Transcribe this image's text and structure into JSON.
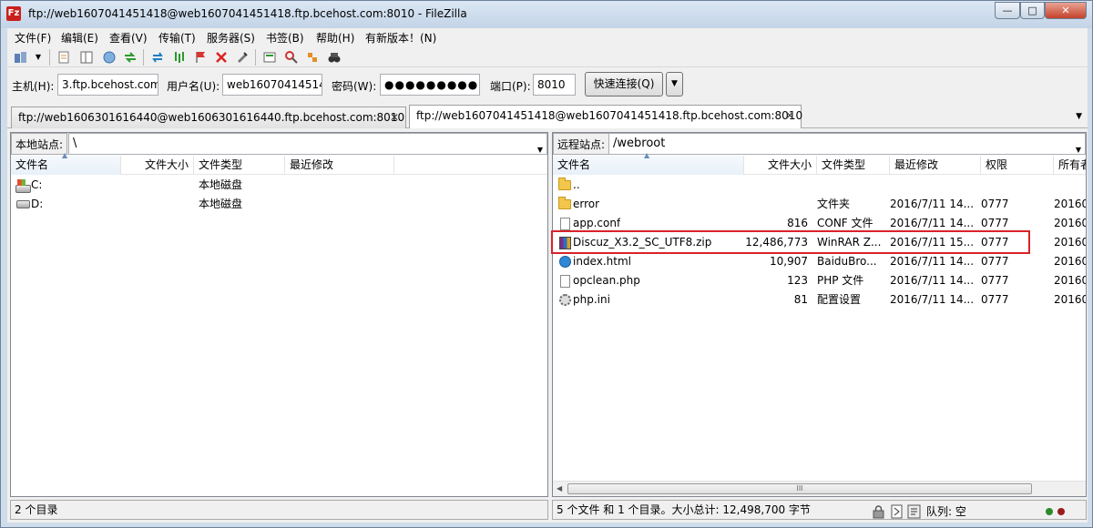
{
  "window": {
    "title": "ftp://web1607041451418@web1607041451418.ftp.bcehost.com:8010 - FileZilla",
    "app_icon": "Fz",
    "controls": {
      "minimize": "—",
      "maximize": "□",
      "close": "✕"
    }
  },
  "menu": [
    "文件(F)",
    "编辑(E)",
    "查看(V)",
    "传输(T)",
    "服务器(S)",
    "书签(B)",
    "帮助(H)",
    "有新版本！(N)"
  ],
  "toolbar_icons": [
    "site-manager-icon",
    "dropdown-arrow-icon",
    "message-log-icon",
    "local-tree-icon",
    "remote-tree-icon",
    "transfer-queue-icon",
    "refresh-icon",
    "process-queue-icon",
    "cancel-icon",
    "disconnect-icon",
    "reconnect-icon",
    "filter-icon",
    "compare-icon",
    "sync-browse-icon",
    "search-icon"
  ],
  "quickconnect": {
    "host_label": "主机(H):",
    "host_value": "3.ftp.bcehost.com",
    "user_label": "用户名(U):",
    "user_value": "web16070414514",
    "pass_label": "密码(W):",
    "pass_value": "●●●●●●●●●",
    "port_label": "端口(P):",
    "port_value": "8010",
    "connect_label": "快速连接(Q)",
    "dropdown": "▼"
  },
  "tabs": [
    {
      "label": "ftp://web1606301616440@web1606301616440.ftp.bcehost.com:8010",
      "close": "✕"
    },
    {
      "label": "ftp://web1607041451418@web1607041451418.ftp.bcehost.com:8010",
      "close": "✕"
    }
  ],
  "tab_scroll": "▼",
  "local": {
    "site_label": "本地站点:",
    "path": "\\",
    "columns": [
      "文件名",
      "文件大小",
      "文件类型",
      "最近修改"
    ],
    "rows": [
      {
        "name": "C:",
        "size": "",
        "type": "本地磁盘",
        "modified": ""
      },
      {
        "name": "D:",
        "size": "",
        "type": "本地磁盘",
        "modified": ""
      }
    ],
    "status": "2 个目录"
  },
  "remote": {
    "site_label": "远程站点:",
    "path": "/webroot",
    "columns": [
      "文件名",
      "文件大小",
      "文件类型",
      "最近修改",
      "权限",
      "所有者"
    ],
    "rows": [
      {
        "name": "..",
        "size": "",
        "type": "",
        "modified": "",
        "perm": "",
        "owner": ""
      },
      {
        "name": "error",
        "size": "",
        "type": "文件夹",
        "modified": "2016/7/11 14...",
        "perm": "0777",
        "owner": "20160"
      },
      {
        "name": "app.conf",
        "size": "816",
        "type": "CONF 文件",
        "modified": "2016/7/11 14...",
        "perm": "0777",
        "owner": "20160"
      },
      {
        "name": "Discuz_X3.2_SC_UTF8.zip",
        "size": "12,486,773",
        "type": "WinRAR Z...",
        "modified": "2016/7/11 15...",
        "perm": "0777",
        "owner": "20160"
      },
      {
        "name": "index.html",
        "size": "10,907",
        "type": "BaiduBro...",
        "modified": "2016/7/11 14...",
        "perm": "0777",
        "owner": "20160"
      },
      {
        "name": "opclean.php",
        "size": "123",
        "type": "PHP 文件",
        "modified": "2016/7/11 14...",
        "perm": "0777",
        "owner": "20160"
      },
      {
        "name": "php.ini",
        "size": "81",
        "type": "配置设置",
        "modified": "2016/7/11 14...",
        "perm": "0777",
        "owner": "20160"
      }
    ],
    "status": "5 个文件 和 1 个目录。大小总计: 12,498,700 字节",
    "scroll": {
      "left": "◀",
      "thumb": "III"
    }
  },
  "bottom": {
    "queue_label": "队列: 空"
  },
  "colors": {
    "highlight": "#d8232a",
    "accent": "#c8211c"
  }
}
